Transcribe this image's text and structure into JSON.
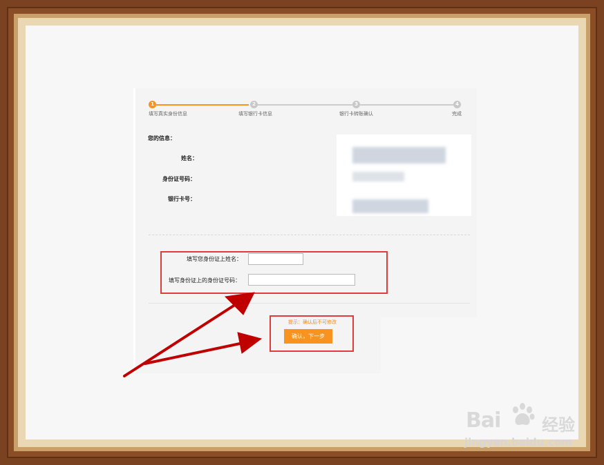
{
  "steps": [
    {
      "num": "1",
      "label": "填写真实身份信息",
      "state": "active"
    },
    {
      "num": "2",
      "label": "填写银行卡信息",
      "state": "inactive"
    },
    {
      "num": "3",
      "label": "银行卡转账确认",
      "state": "inactive"
    },
    {
      "num": "4",
      "label": "完成",
      "state": "inactive"
    }
  ],
  "info": {
    "heading": "您的信息：",
    "name_label": "姓名：",
    "id_label": "身份证号码：",
    "card_label": "银行卡号："
  },
  "form": {
    "name_prompt": "填写您身份证上姓名：",
    "name_value": "",
    "id_prompt": "填写身份证上的身份证号码：",
    "id_value": ""
  },
  "hint": "提示：确认后不可修改",
  "confirm_button": "确认，下一步",
  "watermark": {
    "logo": "Bai",
    "logo_tail": "du",
    "cn": "经验",
    "url": "jingyan.baidu.com"
  },
  "colors": {
    "accent": "#f7931e",
    "annotation": "#e03b3b",
    "arrow": "#c00000"
  }
}
